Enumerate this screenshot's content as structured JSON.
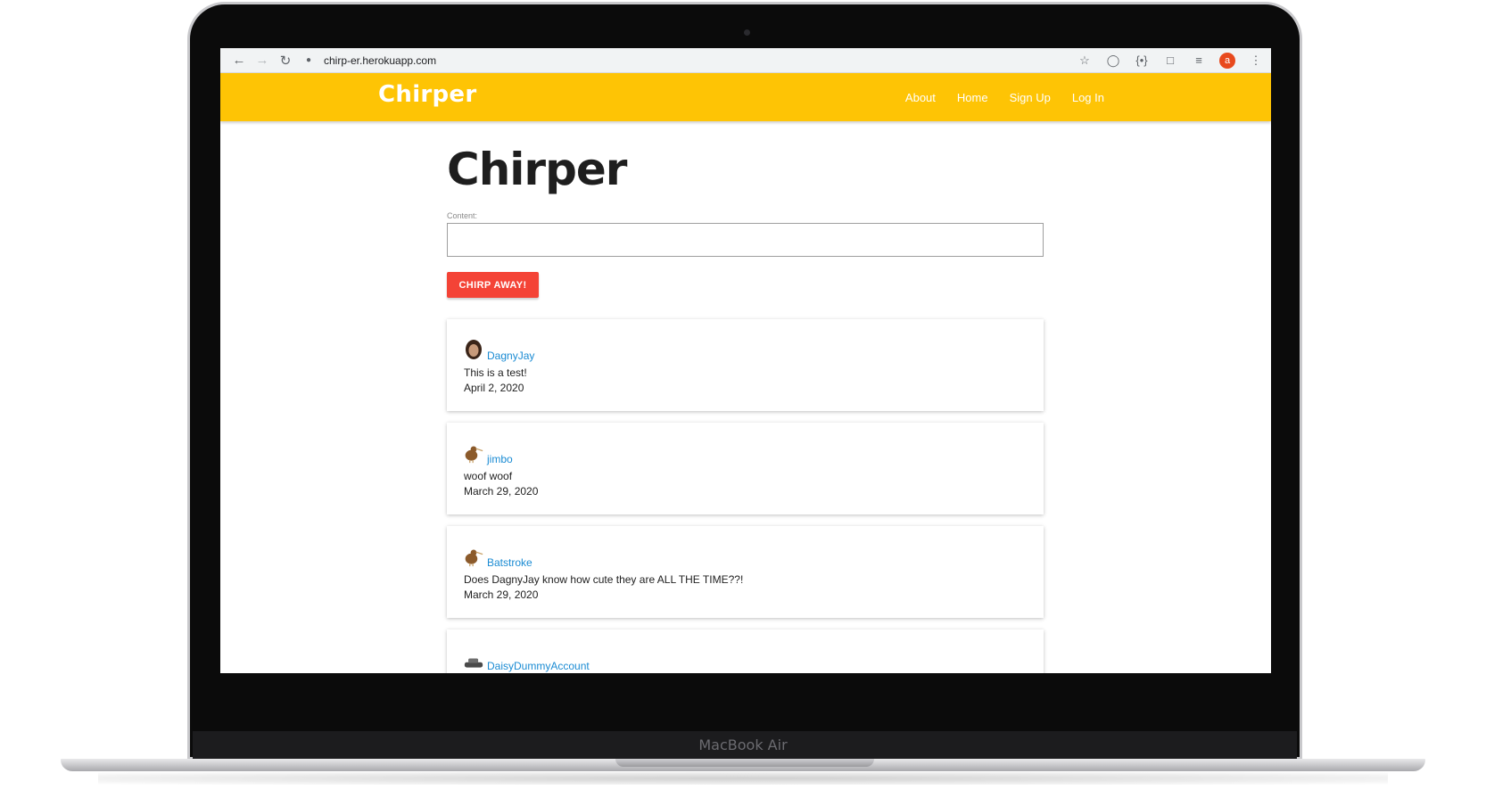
{
  "device": {
    "label": "MacBook Air"
  },
  "browser": {
    "url": "chirp-er.herokuapp.com",
    "profile_initial": "a",
    "icons": [
      "back-icon",
      "forward-icon",
      "reload-icon",
      "lock-icon",
      "star-icon",
      "extension-icon",
      "code-icon",
      "media-icon",
      "menu-icon"
    ]
  },
  "site": {
    "brand": "Chirper",
    "nav": [
      "About",
      "Home",
      "Sign Up",
      "Log In"
    ]
  },
  "page": {
    "title": "Chirper",
    "content_label": "Content:",
    "content_value": "",
    "submit_label": "CHIRP AWAY!"
  },
  "posts": [
    {
      "username": "DagnyJay",
      "text": "This is a test!",
      "date": "April 2, 2020",
      "avatar": "person-avatar"
    },
    {
      "username": "jimbo",
      "text": "woof woof",
      "date": "March 29, 2020",
      "avatar": "kiwi-bird-avatar"
    },
    {
      "username": "Batstroke",
      "text": "Does DagnyJay know how cute they are ALL THE TIME??!",
      "date": "March 29, 2020",
      "avatar": "kiwi-bird-avatar"
    },
    {
      "username": "DaisyDummyAccount",
      "text": "",
      "date": "",
      "avatar": "car-avatar"
    }
  ],
  "colors": {
    "nav_bg": "#fec405",
    "button": "#f44336",
    "link": "#1a8bd3"
  }
}
